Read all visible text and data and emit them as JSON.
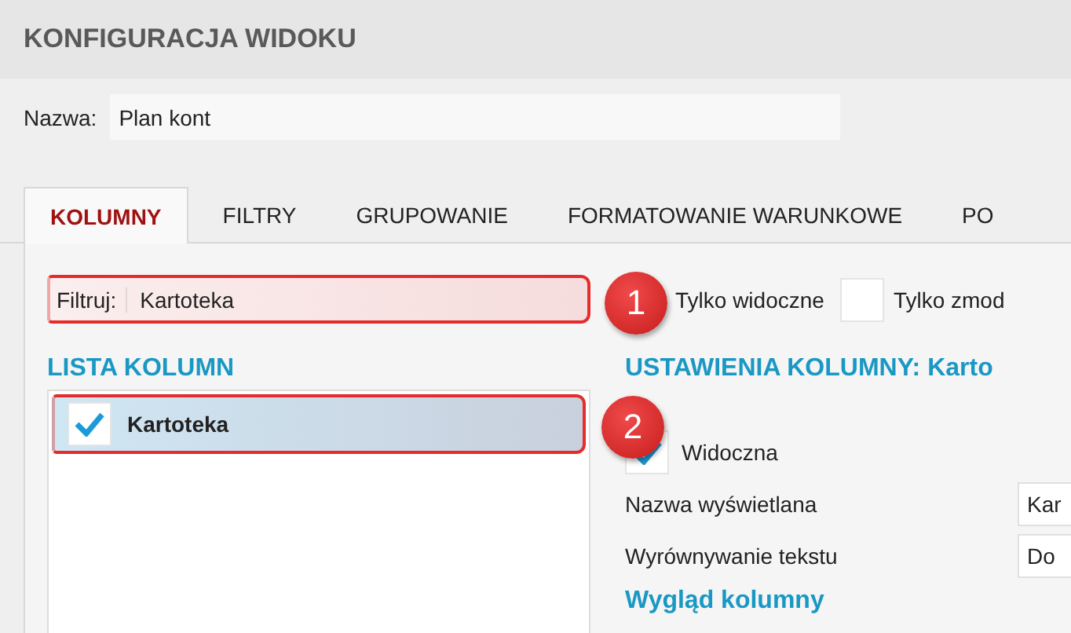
{
  "window": {
    "title": "KONFIGURACJA WIDOKU"
  },
  "name_field": {
    "label": "Nazwa:",
    "value": "Plan kont"
  },
  "tabs": [
    {
      "label": "KOLUMNY",
      "selected": true
    },
    {
      "label": "FILTRY",
      "selected": false
    },
    {
      "label": "GRUPOWANIE",
      "selected": false
    },
    {
      "label": "FORMATOWANIE WARUNKOWE",
      "selected": false
    },
    {
      "label": "PO",
      "selected": false
    }
  ],
  "filter": {
    "label": "Filtruj:",
    "value": "Kartoteka"
  },
  "filter_options": [
    {
      "label": "Tylko widoczne"
    },
    {
      "label": "Tylko zmod",
      "checked": false
    }
  ],
  "column_list": {
    "title": "LISTA KOLUMN",
    "items": [
      {
        "label": "Kartoteka",
        "checked": true,
        "selected": true
      }
    ]
  },
  "column_settings": {
    "title": "USTAWIENIA KOLUMNY: Karto",
    "visible": {
      "label": "Widoczna",
      "checked": true
    },
    "fields": [
      {
        "label": "Nazwa wyświetlana",
        "value": "Kar"
      },
      {
        "label": "Wyrównywanie tekstu",
        "value": "Do"
      }
    ],
    "section": "Wygląd kolumny"
  },
  "callouts": [
    {
      "number": "1"
    },
    {
      "number": "2"
    }
  ]
}
